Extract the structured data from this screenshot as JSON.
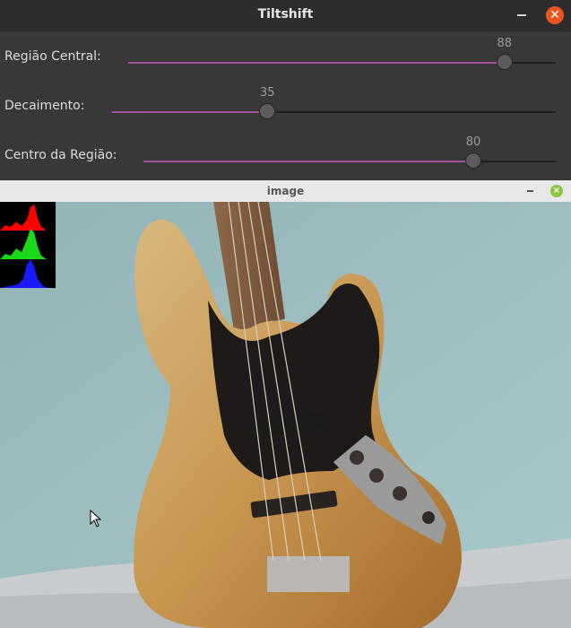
{
  "window": {
    "title": "Tiltshift",
    "close_glyph": "✕"
  },
  "sliders": [
    {
      "label": "Região Central:",
      "value": "88",
      "level": 0.88
    },
    {
      "label": "Decaimento:",
      "value": "35",
      "level": 0.35
    },
    {
      "label": "Centro da Região:",
      "value": "80",
      "level": 0.8
    }
  ],
  "image_window": {
    "title": "image",
    "close_glyph": "×"
  },
  "colors": {
    "accent": "#a34fa3",
    "close": "#e95420",
    "image_close": "#8cc63f"
  }
}
